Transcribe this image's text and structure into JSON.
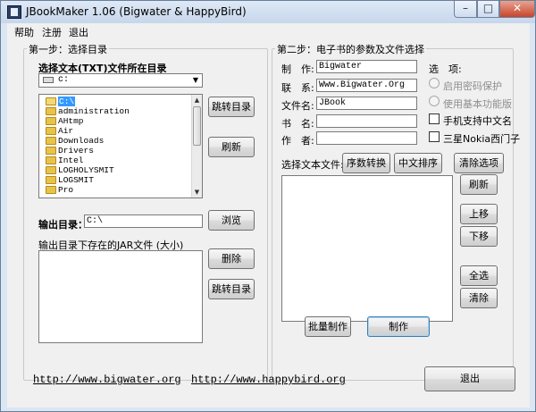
{
  "window": {
    "title": "JBookMaker 1.06 (Bigwater & HappyBird)",
    "min_glyph": "–",
    "max_glyph": "□",
    "close_glyph": "✕"
  },
  "menu": [
    "帮助",
    "注册",
    "退出"
  ],
  "step1": {
    "title": "第一步：选择目录",
    "source_label": "选择文本(TXT)文件所在目录",
    "drive": "c:",
    "dropdown_arrow": "▼",
    "folders": [
      "C:\\",
      "administration",
      "AHtmp",
      "Air",
      "Downloads",
      "Drivers",
      "Intel",
      "LOGHOLYSMIT",
      "LOGSMIT",
      "Pro"
    ],
    "jump_label": "跳转目录",
    "refresh_label": "刷新",
    "output_label": "输出目录：",
    "output_value": "C:\\",
    "browse_label": "浏览",
    "jar_list_label": "输出目录下存在的JAR文件 (大小)",
    "delete_label": "删除",
    "jump2_label": "跳转目录"
  },
  "step2": {
    "title": "第二步：电子书的参数及文件选择",
    "author_label": "制　作:",
    "author_value": "Bigwater",
    "contact_label": "联　系:",
    "contact_value": "Www.Bigwater.Org",
    "filename_label": "文件名:",
    "filename_value": "JBook",
    "bookname_label": "书　名:",
    "bookname_value": "",
    "writer_label": "作　者:",
    "writer_value": "",
    "options_label": "选　项:",
    "opt_password": "启用密码保护",
    "opt_basic": "使用基本功能版",
    "opt_chinese": "手机支持中文名",
    "opt_nokia": "三星Nokia西门子",
    "select_files_label": "选择文本文件:",
    "order_convert_label": "序数转换",
    "chinese_sort_label": "中文排序",
    "clear_select_label": "清除选项",
    "refresh_label": "刷新",
    "up_label": "上移",
    "down_label": "下移",
    "select_all_label": "全选",
    "clear_label": "清除",
    "batch_label": "批量制作",
    "make_label": "制作"
  },
  "footer": {
    "link1": "http://www.bigwater.org",
    "link2": "http://www.happybird.org",
    "exit_label": "退出"
  }
}
